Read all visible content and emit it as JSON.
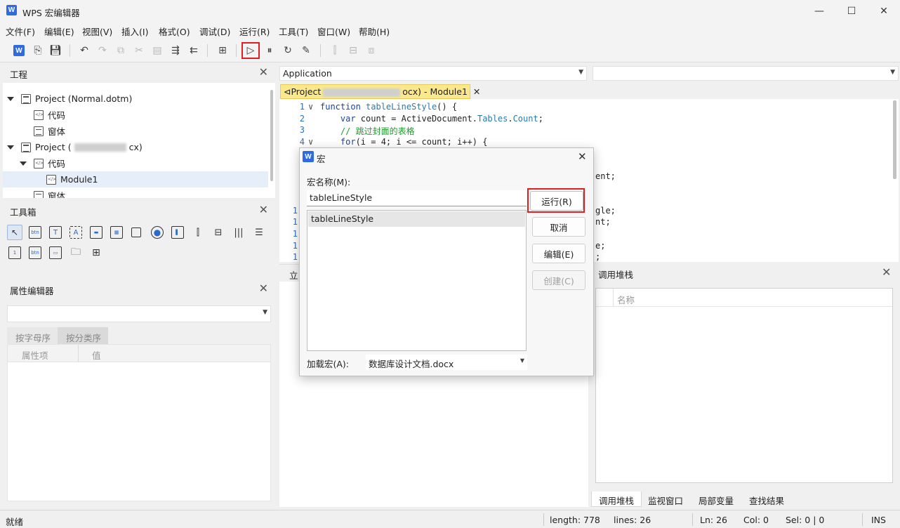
{
  "window": {
    "title": "WPS 宏编辑器",
    "minimize": "—",
    "maximize": "☐",
    "close": "✕"
  },
  "menu": [
    "文件(F)",
    "编辑(E)",
    "视图(V)",
    "插入(I)",
    "格式(O)",
    "调试(D)",
    "运行(R)",
    "工具(T)",
    "窗口(W)",
    "帮助(H)"
  ],
  "project_panel": {
    "title": "工程",
    "items": [
      {
        "label": "Project (Normal.dotm)"
      },
      {
        "label": "代码"
      },
      {
        "label": "窗体"
      },
      {
        "label_prefix": "Project (",
        "label_suffix": "cx)"
      },
      {
        "label": "代码"
      },
      {
        "label": "Module1"
      },
      {
        "label": "窗体"
      }
    ]
  },
  "toolbox_panel": {
    "title": "工具箱"
  },
  "property_panel": {
    "title": "属性编辑器",
    "tabs": [
      "按字母序",
      "按分类序"
    ],
    "columns": [
      "属性项",
      "值"
    ]
  },
  "editor": {
    "object_dropdown": "Application",
    "proc_dropdown": "",
    "tab_prefix": "Project",
    "tab_suffix": "ocx) - Module1",
    "code": [
      {
        "n": "1",
        "fold": "∨"
      },
      {
        "n": "2",
        "fold": ""
      },
      {
        "n": "3",
        "fold": ""
      },
      {
        "n": "4",
        "fold": "∨"
      }
    ],
    "code_text": {
      "l1_kw": "function",
      "l1_fn": " tableLineStyle",
      "l1_rest": "() {",
      "l2_kw": "    var",
      "l2_a": " count = ActiveDocument.",
      "l2_b": "Tables",
      "l2_c": ".",
      "l2_d": "Count",
      "l2_e": ";",
      "l3": "    // 跳过封面的表格",
      "l4_kw": "    for",
      "l4_rest": "(i = 4; i <= count; i++) {"
    },
    "partial_right": [
      "ent;",
      "gle;",
      "nt;",
      "e;",
      ";"
    ],
    "partial_left": [
      "1",
      "1",
      "1",
      "1",
      "1"
    ],
    "immediate_label": "立"
  },
  "callstack_panel": {
    "title": "调用堆栈",
    "column": "名称",
    "tabs": [
      "调用堆栈",
      "监视窗口",
      "局部变量",
      "查找结果"
    ]
  },
  "dialog": {
    "title": "宏",
    "macro_name_label": "宏名称(M):",
    "macro_name_value": "tableLineStyle",
    "macros": [
      "tableLineStyle"
    ],
    "buttons": {
      "run": "运行(R)",
      "cancel": "取消",
      "edit": "编辑(E)",
      "create": "创建(C)"
    },
    "load_label": "加载宏(A):",
    "load_value": "数据库设计文档.docx"
  },
  "status": {
    "ready": "就绪",
    "length": "length: 778",
    "lines": "lines: 26",
    "ln": "Ln: 26",
    "col": "Col: 0",
    "sel": "Sel: 0 | 0",
    "ins": "INS"
  },
  "colors": {
    "highlight_red": "#e02020",
    "accent": "#2f6be0",
    "tab_yellow": "#fbe88c"
  }
}
